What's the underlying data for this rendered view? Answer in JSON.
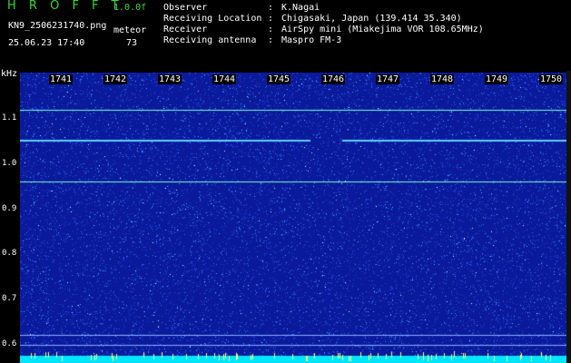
{
  "header": {
    "app_title": "H R O F F T",
    "version": "1.0.0f",
    "filename": "KN9_2506231740.png",
    "datetime": "25.06.23 17:40",
    "meteor_label": "meteor",
    "meteor_count": "73",
    "info": [
      {
        "key": "Observer",
        "sep": ":",
        "value": "K.Nagai"
      },
      {
        "key": "Receiving Location",
        "sep": ":",
        "value": "Chigasaki, Japan (139.414 35.340)"
      },
      {
        "key": "Receiver",
        "sep": ":",
        "value": "AirSpy mini (Miakejima VOR 108.65MHz)"
      },
      {
        "key": "Receiving antenna",
        "sep": ":",
        "value": "Maspro FM-3"
      }
    ]
  },
  "spectrogram": {
    "y_unit": "kHz",
    "y_ticks": [
      "1.1",
      "1.0",
      "0.9",
      "0.8",
      "0.7",
      "0.6"
    ],
    "x_ticks": [
      "1741",
      "1742",
      "1743",
      "1744",
      "1745",
      "1746",
      "1747",
      "1748",
      "1749",
      "1750"
    ],
    "colors": {
      "background": "#0a1a9a",
      "noise": "#2a6cff",
      "signal": "#7fffd0",
      "text": "#38d838",
      "bottom_band": "#00e5ff"
    }
  }
}
